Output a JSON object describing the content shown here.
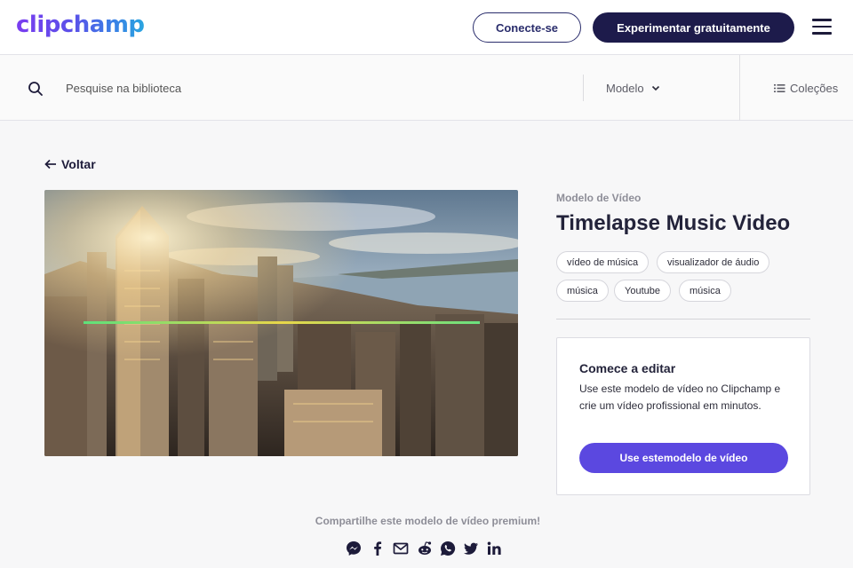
{
  "header": {
    "logo_text": "clipchamp",
    "login_label": "Conecte-se",
    "try_label": "Experimentar gratuitamente",
    "menu_icon": "hamburger-menu-icon"
  },
  "searchbar": {
    "placeholder": "Pesquise na biblioteca",
    "search_icon": "search-icon",
    "filter_label": "Modelo",
    "collections_label": "Coleções"
  },
  "content": {
    "back_label": "Voltar",
    "preview_alt": "Timelapse Music Video",
    "template_kind": "Modelo de Vídeo",
    "title": "Timelapse Music Video",
    "tags": [
      "vídeo de música",
      "visualizador de áudio",
      "música",
      "Youtube",
      "música"
    ]
  },
  "edit_card": {
    "heading": "Comece a editar",
    "description": "Use este modelo de vídeo no Clipchamp e crie um vídeo profissional em minutos.",
    "button_label": "Use estemodelo de vídeo"
  },
  "share": {
    "text": "Compartilhe este modelo de vídeo premium!",
    "icons": [
      "messenger-icon",
      "facebook-icon",
      "email-icon",
      "reddit-icon",
      "whatsapp-icon",
      "twitter-icon",
      "linkedin-icon"
    ]
  },
  "colors": {
    "navy": "#1d1b4b",
    "accent": "#5b48e0",
    "logo_gradient_start": "#7a3cf0",
    "logo_gradient_end": "#2aa6e0"
  }
}
